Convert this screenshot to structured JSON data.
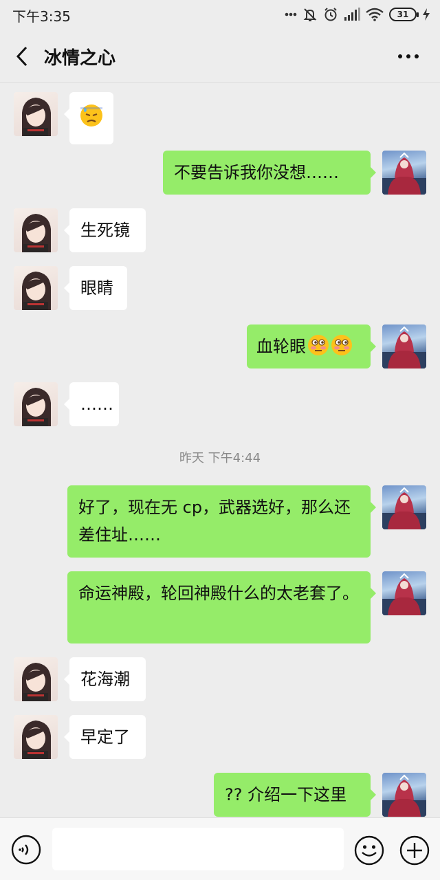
{
  "status_bar": {
    "time": "下午3:35",
    "battery": "31"
  },
  "header": {
    "title": "冰情之心"
  },
  "messages": [
    {
      "side": "left",
      "text": "",
      "emoji": "downcast-sweat-emoji"
    },
    {
      "side": "right",
      "text": "不要告诉我你没想……"
    },
    {
      "side": "left",
      "text": "生死镜"
    },
    {
      "side": "left",
      "text": "眼睛"
    },
    {
      "side": "right",
      "text": "血轮眼",
      "emoji": "flushed-emoji x2"
    },
    {
      "side": "left",
      "text": "……"
    },
    {
      "side": "right",
      "text": "好了，现在无 cp，武器选好，那么还差住址……"
    },
    {
      "side": "right",
      "text": "命运神殿，轮回神殿什么的太老套了。"
    },
    {
      "side": "left",
      "text": "花海潮"
    },
    {
      "side": "left",
      "text": "早定了"
    },
    {
      "side": "right",
      "text": "?? 介绍一下这里"
    }
  ],
  "timestamp": "昨天 下午4:44",
  "input_bar": {
    "placeholder": ""
  },
  "colors": {
    "my_bubble": "#95ec69",
    "their_bubble": "#ffffff",
    "background": "#ededed"
  }
}
